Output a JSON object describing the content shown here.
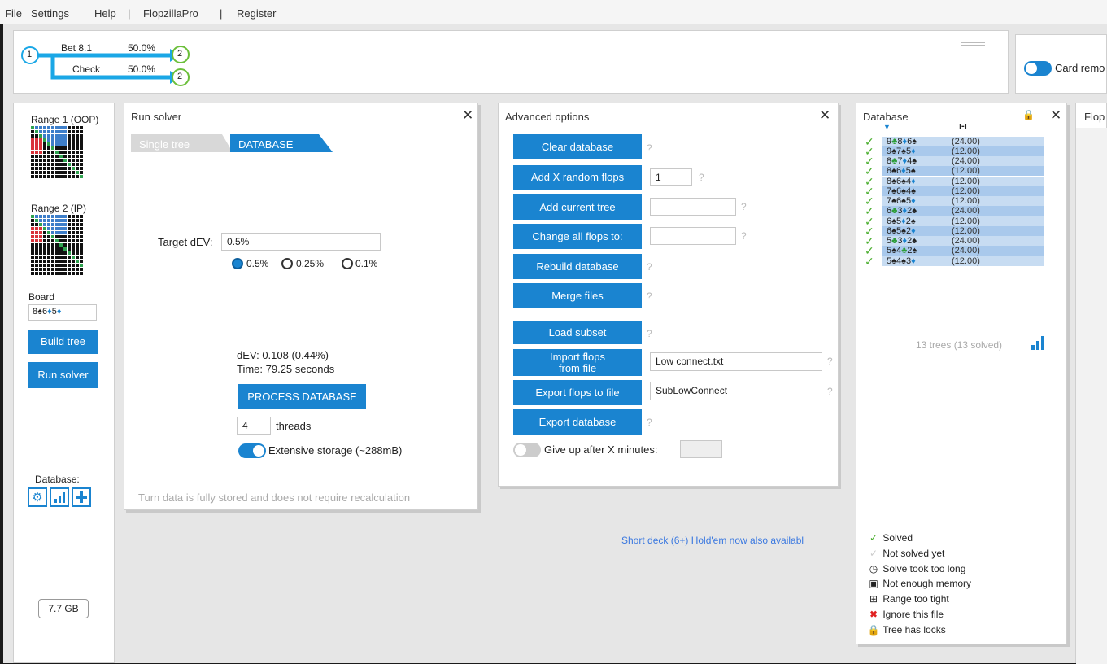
{
  "menu": {
    "items": [
      "File",
      "Settings",
      "Help",
      "|",
      "FlopzillaPro",
      "|",
      "Register"
    ]
  },
  "tree": {
    "root_node": "1",
    "branches": [
      {
        "label": "Bet 8.1",
        "pct": "50.0%",
        "node": "2"
      },
      {
        "label": "Check",
        "pct": "50.0%",
        "node": "2"
      }
    ]
  },
  "card_removal": {
    "label": "Card remo"
  },
  "left": {
    "range1": "Range 1 (OOP)",
    "range2": "Range 2 (IP)",
    "board_label": "Board",
    "board_value": "8♠6♦5♦",
    "build_tree": "Build tree",
    "run_solver": "Run solver",
    "database_label": "Database:",
    "memory": "7.7 GB"
  },
  "run_solver": {
    "title": "Run solver",
    "tab_single": "Single tree",
    "tab_database": "DATABASE",
    "target_label": "Target dEV:",
    "target_value": "0.5%",
    "radio_options": [
      "0.5%",
      "0.25%",
      "0.1%"
    ],
    "radio_selected": "0.5%",
    "dev": "dEV: 0.108 (0.44%)",
    "time": "Time: 79.25 seconds",
    "process_button": "PROCESS DATABASE",
    "threads_value": "4",
    "threads_label": "threads",
    "extensive_storage": "Extensive storage (~288mB)",
    "footer_note": "Turn data is fully stored and does not require recalculation"
  },
  "advanced": {
    "title": "Advanced options",
    "clear_db": "Clear database",
    "add_random": "Add X random flops",
    "add_random_value": "1",
    "add_current": "Add current tree",
    "change_flops": "Change all flops to:",
    "rebuild": "Rebuild database",
    "merge": "Merge files",
    "load_subset": "Load subset",
    "import_flops_line1": "Import flops",
    "import_flops_line2": "from file",
    "import_value": "Low connect.txt",
    "export_flops": "Export flops to file",
    "export_value": "SubLowConnect",
    "export_db": "Export database",
    "give_up": "Give up after X minutes:",
    "help_mark": "?"
  },
  "short_deck_notice": "Short deck (6+) Hold'em now also availabl",
  "database": {
    "title": "Database",
    "rows": [
      {
        "cards": [
          {
            "r": "9",
            "s": "♣"
          },
          {
            "r": "8",
            "s": "♦"
          },
          {
            "r": "6",
            "s": "♠"
          }
        ],
        "value": "(24.00)"
      },
      {
        "cards": [
          {
            "r": "9",
            "s": "♠"
          },
          {
            "r": "7",
            "s": "♠"
          },
          {
            "r": "5",
            "s": "♦"
          }
        ],
        "value": "(12.00)"
      },
      {
        "cards": [
          {
            "r": "8",
            "s": "♣"
          },
          {
            "r": "7",
            "s": "♦"
          },
          {
            "r": "4",
            "s": "♠"
          }
        ],
        "value": "(24.00)"
      },
      {
        "cards": [
          {
            "r": "8",
            "s": "♠"
          },
          {
            "r": "6",
            "s": "♦"
          },
          {
            "r": "5",
            "s": "♠"
          }
        ],
        "value": "(12.00)"
      },
      {
        "cards": [
          {
            "r": "8",
            "s": "♠"
          },
          {
            "r": "6",
            "s": "♠"
          },
          {
            "r": "4",
            "s": "♦"
          }
        ],
        "value": "(12.00)"
      },
      {
        "cards": [
          {
            "r": "7",
            "s": "♠"
          },
          {
            "r": "6",
            "s": "♠"
          },
          {
            "r": "4",
            "s": "♠"
          }
        ],
        "value": "(12.00)"
      },
      {
        "cards": [
          {
            "r": "7",
            "s": "♠"
          },
          {
            "r": "6",
            "s": "♠"
          },
          {
            "r": "5",
            "s": "♦"
          }
        ],
        "value": "(12.00)"
      },
      {
        "cards": [
          {
            "r": "6",
            "s": "♣"
          },
          {
            "r": "3",
            "s": "♦"
          },
          {
            "r": "2",
            "s": "♠"
          }
        ],
        "value": "(24.00)"
      },
      {
        "cards": [
          {
            "r": "6",
            "s": "♠"
          },
          {
            "r": "5",
            "s": "♦"
          },
          {
            "r": "2",
            "s": "♠"
          }
        ],
        "value": "(12.00)"
      },
      {
        "cards": [
          {
            "r": "6",
            "s": "♠"
          },
          {
            "r": "5",
            "s": "♠"
          },
          {
            "r": "2",
            "s": "♦"
          }
        ],
        "value": "(12.00)"
      },
      {
        "cards": [
          {
            "r": "5",
            "s": "♣"
          },
          {
            "r": "3",
            "s": "♦"
          },
          {
            "r": "2",
            "s": "♠"
          }
        ],
        "value": "(24.00)"
      },
      {
        "cards": [
          {
            "r": "5",
            "s": "♠"
          },
          {
            "r": "4",
            "s": "♣"
          },
          {
            "r": "2",
            "s": "♠"
          }
        ],
        "value": "(24.00)"
      },
      {
        "cards": [
          {
            "r": "5",
            "s": "♠"
          },
          {
            "r": "4",
            "s": "♠"
          },
          {
            "r": "3",
            "s": "♦"
          }
        ],
        "value": "(12.00)"
      }
    ],
    "summary": "13 trees (13 solved)",
    "legend": [
      {
        "icon": "check-icon",
        "glyph": "✓",
        "label": "Solved"
      },
      {
        "icon": "check-grey-icon",
        "glyph": "✓",
        "label": "Not solved yet"
      },
      {
        "icon": "clock-icon",
        "glyph": "◷",
        "label": "Solve took too long"
      },
      {
        "icon": "memory-icon",
        "glyph": "▣",
        "label": "Not enough memory"
      },
      {
        "icon": "grid-icon",
        "glyph": "⊞",
        "label": "Range too tight"
      },
      {
        "icon": "x-icon",
        "glyph": "✖",
        "label": "Ignore this file"
      },
      {
        "icon": "lock-icon",
        "glyph": "🔒",
        "label": "Tree has locks"
      }
    ]
  },
  "flop_panel": {
    "title": "Flop"
  },
  "colors": {
    "accent": "#1a84d0",
    "tree_line": "#1aa7e6",
    "node_ring": "#6bbf3a",
    "check": "#4caf30",
    "row_a": "#c7dcf2",
    "row_b": "#a9c9ec",
    "suit_club": "#2e9e3a",
    "suit_diamond": "#1a84d0",
    "suit_spade": "#222222"
  }
}
